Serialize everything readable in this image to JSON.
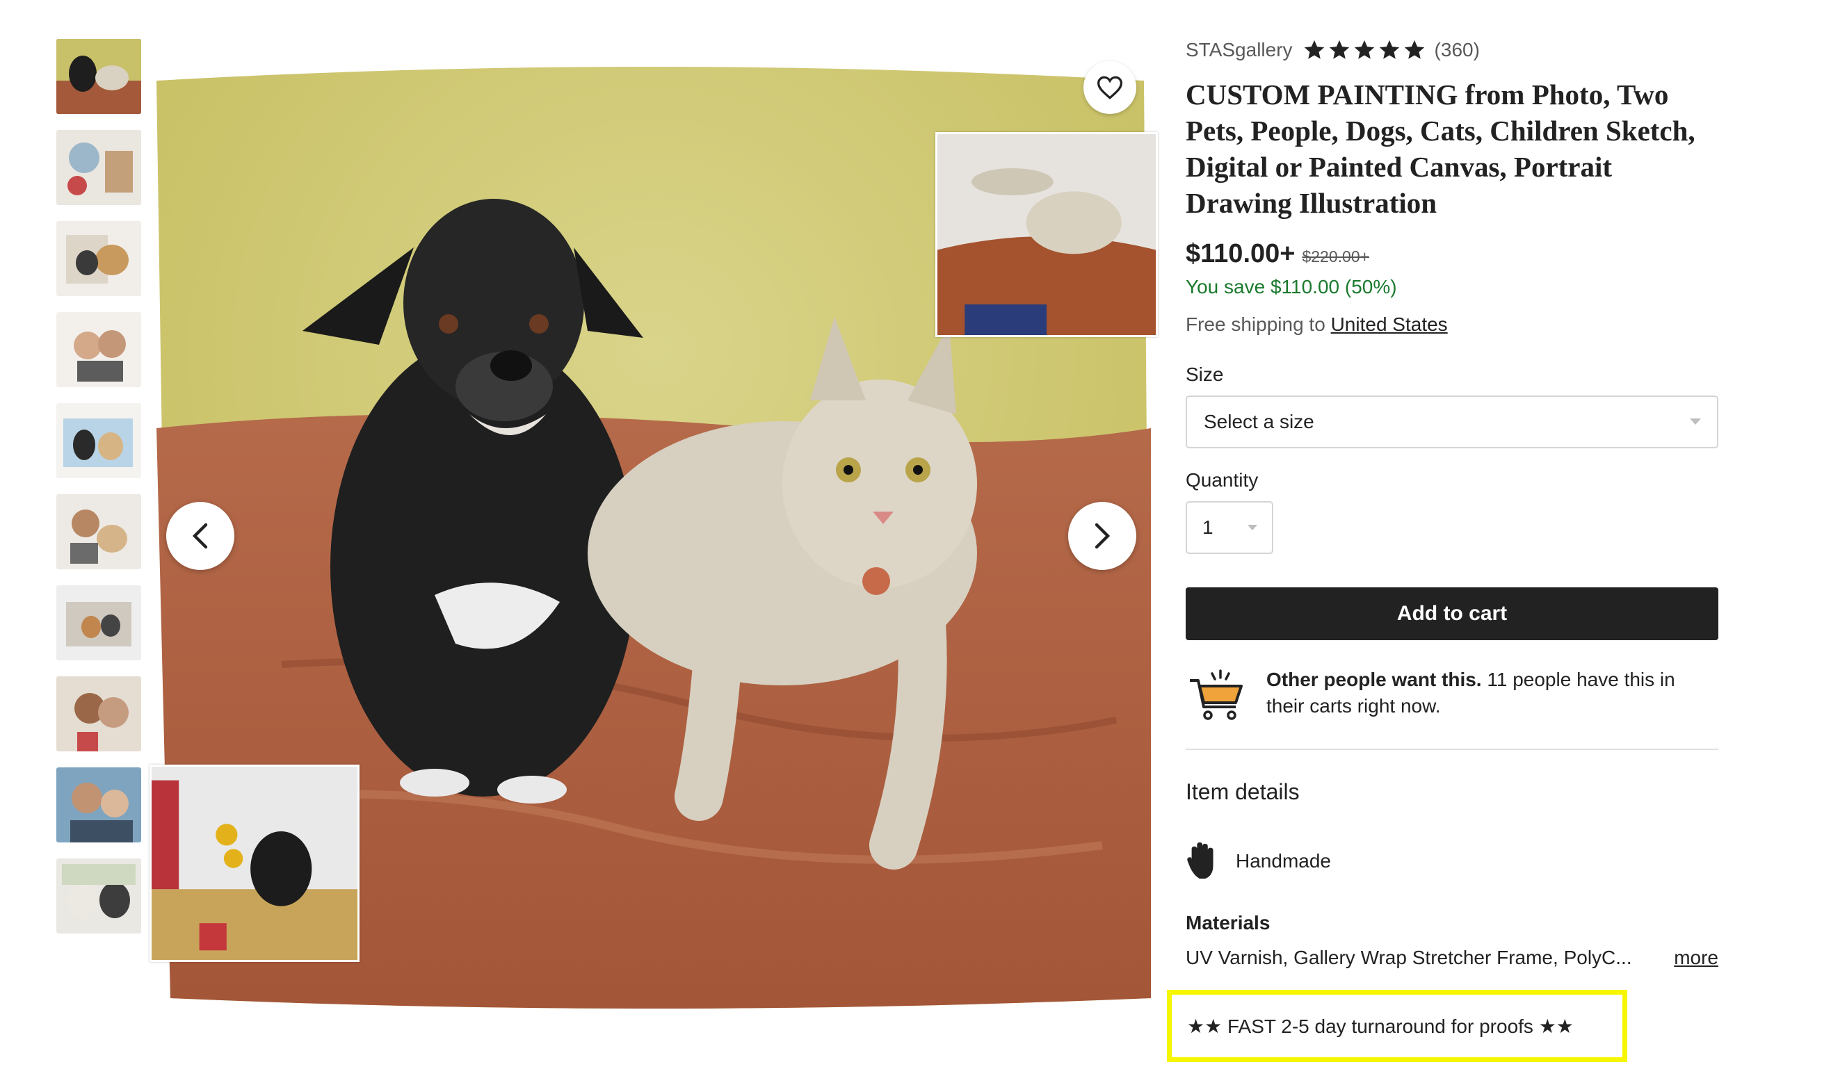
{
  "gallery": {
    "thumbnail_count": 10,
    "favorite_icon": "heart-icon",
    "prev_icon": "chevron-left-icon",
    "next_icon": "chevron-right-icon"
  },
  "shop": {
    "name": "STASgallery",
    "rating": 5,
    "review_count": "(360)"
  },
  "listing": {
    "title": "CUSTOM PAINTING from Photo, Two Pets, People, Dogs, Cats, Children Sketch, Digital or Painted Canvas, Portrait Drawing Illustration",
    "price": "$110.00+",
    "original_price": "$220.00+",
    "savings": "You save $110.00 (50%)",
    "shipping_prefix": "Free shipping to",
    "shipping_destination": "United States"
  },
  "size": {
    "label": "Size",
    "placeholder": "Select a size"
  },
  "quantity": {
    "label": "Quantity",
    "value": "1"
  },
  "cart": {
    "button_label": "Add to cart"
  },
  "demand": {
    "bold": "Other people want this.",
    "text": " 11 people have this in their carts right now."
  },
  "details": {
    "heading": "Item details",
    "handmade_label": "Handmade",
    "materials_heading": "Materials",
    "materials_text": "UV Varnish, Gallery Wrap Stretcher Frame, PolyC...",
    "more_label": "more"
  },
  "promo": {
    "text": "★★ FAST 2-5 day turnaround for proofs ★★"
  },
  "colors": {
    "savings_green": "#1b7a2e",
    "button_dark": "#222222",
    "highlight_yellow": "#f6f600",
    "cart_orange": "#f1a33b"
  }
}
